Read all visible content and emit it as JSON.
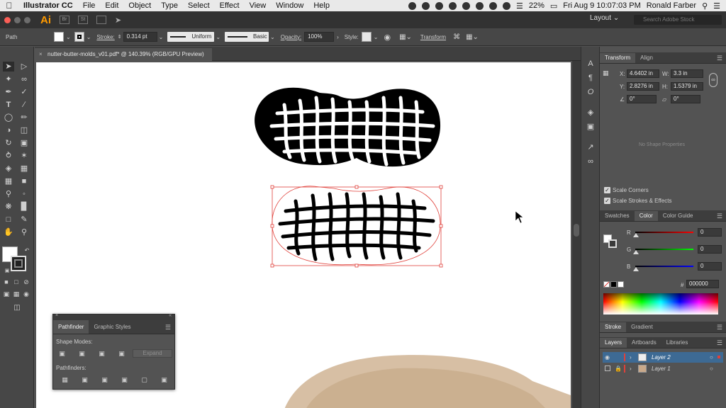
{
  "menubar": {
    "app_name": "Illustrator CC",
    "items": [
      "File",
      "Edit",
      "Object",
      "Type",
      "Select",
      "Effect",
      "View",
      "Window",
      "Help"
    ],
    "battery": "22%",
    "datetime": "Fri Aug 9  10:07:03 PM",
    "user": "Ronald Farber"
  },
  "appbar": {
    "logo": "Ai",
    "bridge_icon": "Br",
    "stock_icon": "St",
    "workspace": "Layout",
    "search_placeholder": "Search Adobe Stock"
  },
  "controlbar": {
    "object_type": "Path",
    "stroke_label": "Stroke:",
    "stroke_weight": "0.314 pt",
    "stroke_profile": "Uniform",
    "brush": "Basic",
    "opacity_label": "Opacity:",
    "opacity": "100%",
    "style_label": "Style:",
    "transform_link": "Transform",
    "fill_color": "#ffffff",
    "stroke_color": "#000000"
  },
  "document": {
    "tab_title": "nutter-butter-molds_v01.pdf* @ 140.39% (RGB/GPU Preview)"
  },
  "transform_panel": {
    "tabs": [
      "Transform",
      "Align"
    ],
    "x_label": "X:",
    "x": "4.6402 in",
    "y_label": "Y:",
    "y": "2.8276 in",
    "w_label": "W:",
    "w": "3.3 in",
    "h_label": "H:",
    "h": "1.5379 in",
    "rotate": "0°",
    "shear": "0°",
    "no_shape": "No Shape Properties",
    "scale_corners": "Scale Corners",
    "scale_strokes": "Scale Strokes & Effects"
  },
  "color_panel": {
    "tabs": [
      "Swatches",
      "Color",
      "Color Guide"
    ],
    "r_label": "R",
    "r": "0",
    "g_label": "G",
    "g": "0",
    "b_label": "B",
    "b": "0",
    "hex_label": "#",
    "hex": "000000"
  },
  "stroke_panel": {
    "tabs": [
      "Stroke",
      "Gradient"
    ]
  },
  "layers_panel": {
    "tabs": [
      "Layers",
      "Artboards",
      "Libraries"
    ],
    "layers": [
      {
        "name": "Layer 2",
        "color": "#e0403a",
        "selected": true
      },
      {
        "name": "Layer 1",
        "color": "#e0403a",
        "selected": false
      }
    ]
  },
  "pathfinder_panel": {
    "tabs": [
      "Pathfinder",
      "Graphic Styles"
    ],
    "shape_modes": "Shape Modes:",
    "expand": "Expand",
    "pathfinders": "Pathfinders:"
  },
  "colors": {
    "selection": "#e0403a",
    "accent": "#2d7ad6"
  }
}
